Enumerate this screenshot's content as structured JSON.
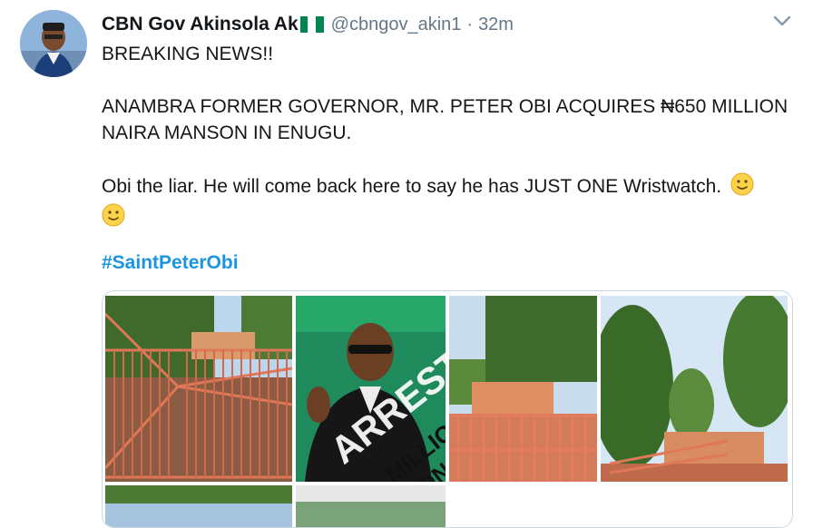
{
  "tweet": {
    "display_name": "CBN Gov Akinsola Ak",
    "handle": "@cbngov_akin1",
    "separator": "·",
    "time": "32m",
    "lines": {
      "line1": "BREAKING NEWS!!",
      "line2": "ANAMBRA FORMER GOVERNOR, MR. PETER OBI ACQUIRES ₦650 MILLION",
      "line3": "NAIRA MANSON IN ENUGU.",
      "line4": "Obi the liar. He will come back here to say he has JUST ONE Wristwatch."
    },
    "hashtag": "#SaintPeterObi"
  },
  "icons": {
    "flag": "nigeria-flag-icon",
    "caret": "chevron-down-icon",
    "emoji": "slightly-smiling-face-icon"
  },
  "media": {
    "overlay_text": "ARRESTED !!!",
    "overlay_text_2": "MILLION",
    "overlay_text_3": "ON IN"
  },
  "colors": {
    "hashtag": "#1b95e0",
    "muted": "#657786",
    "flag_green": "#008751",
    "gate_orange": "#e0735a"
  }
}
